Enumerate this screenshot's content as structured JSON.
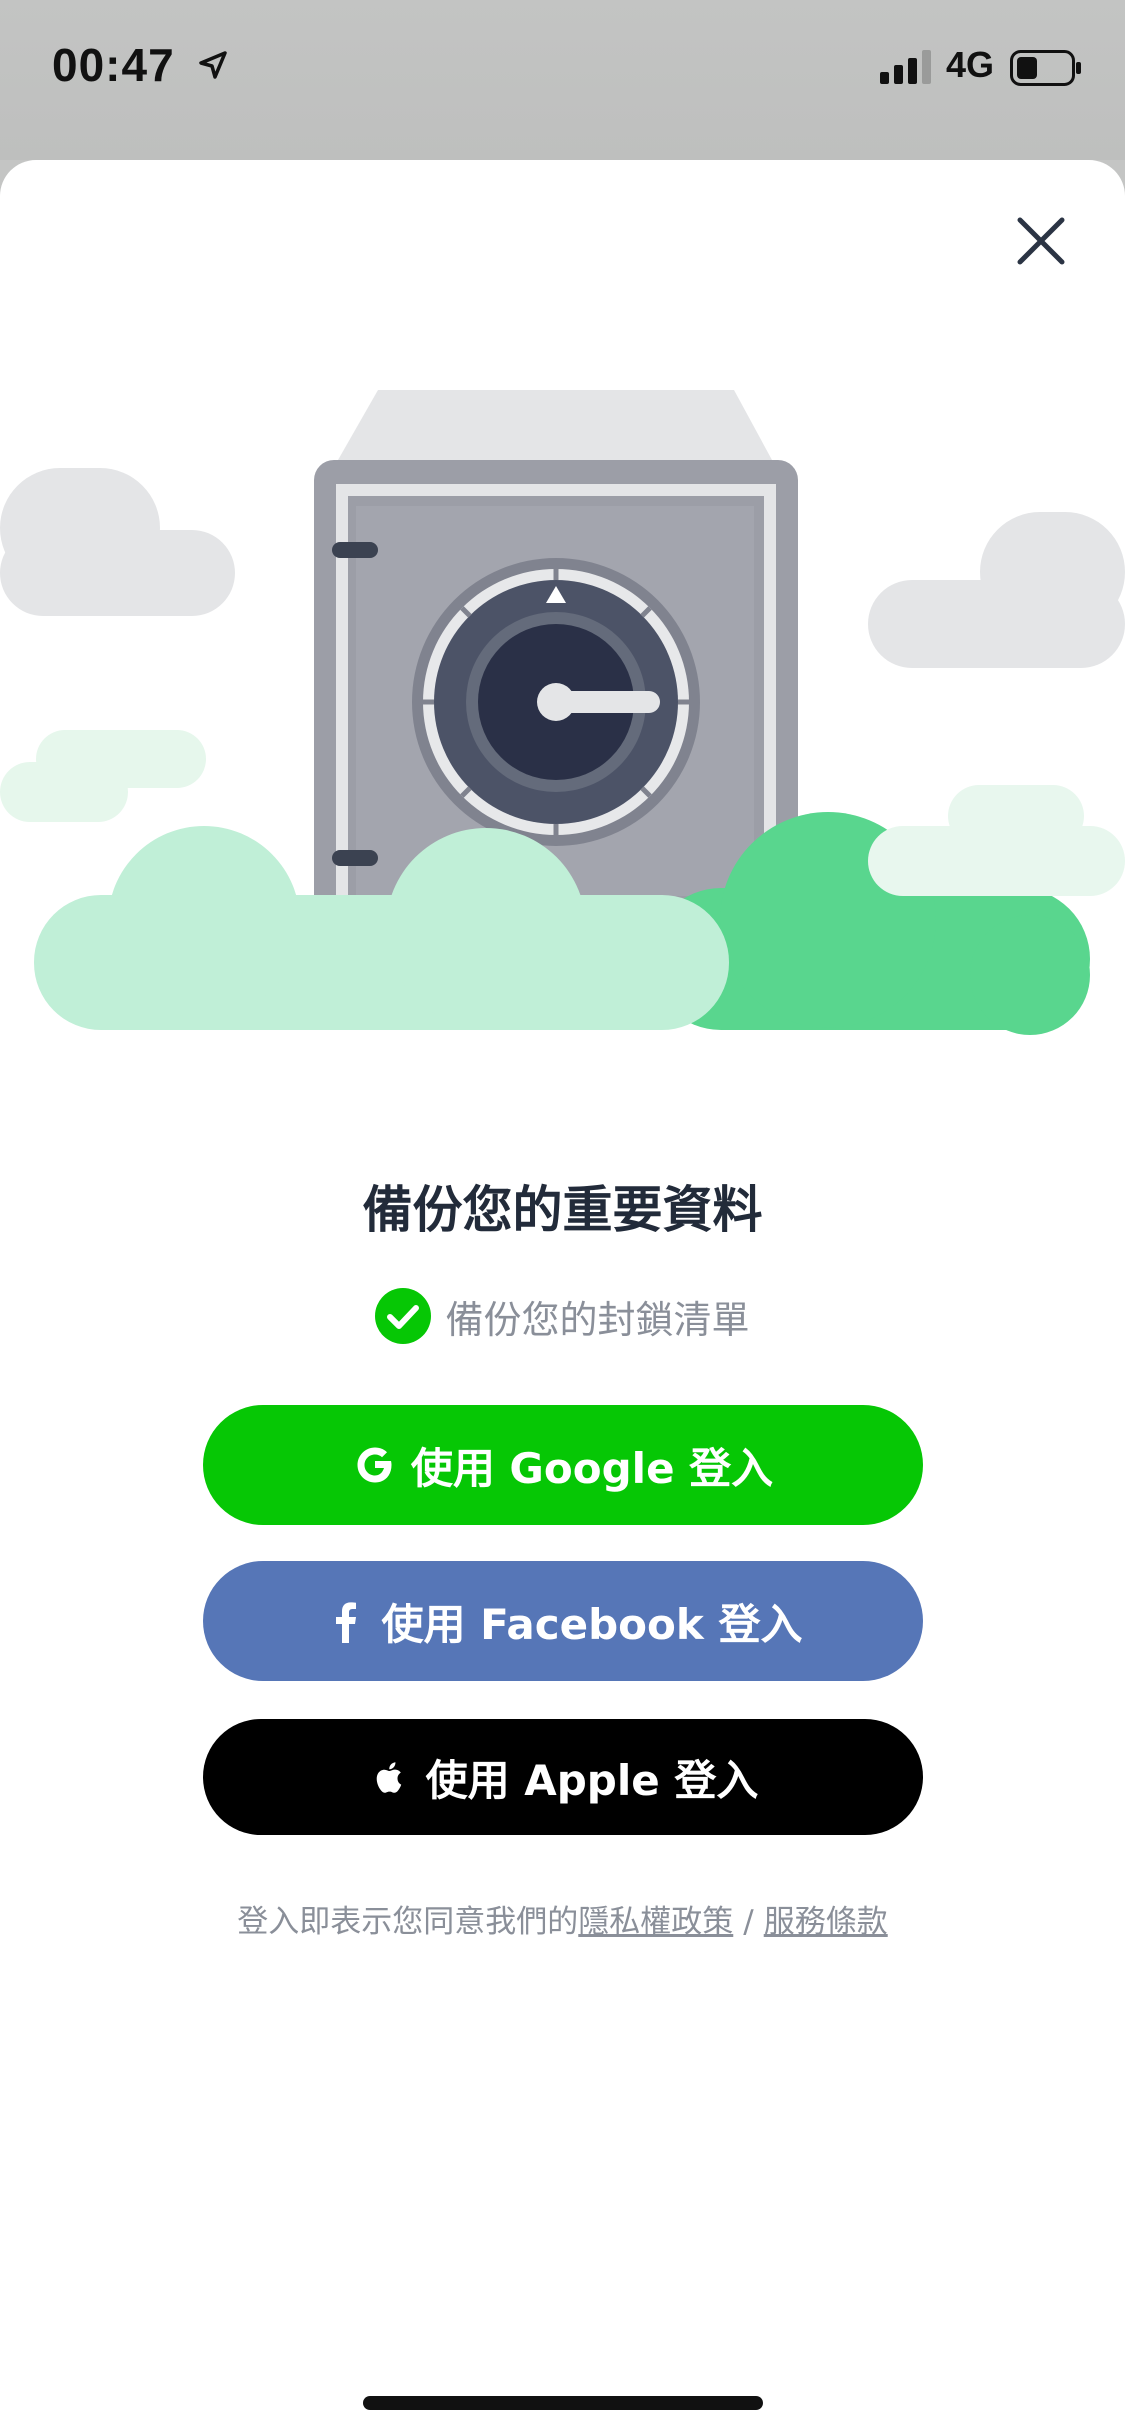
{
  "status_bar": {
    "time": "00:47",
    "network": "4G",
    "icons": [
      "location-arrow-icon",
      "cellular-signal-icon",
      "battery-icon"
    ]
  },
  "sheet": {
    "close_icon": "close-icon",
    "illustration": "safe-vault-with-clouds",
    "headline": "備份您的重要資料",
    "feature": "備份您的封鎖清單",
    "feature_icon": "check-circle-icon"
  },
  "buttons": {
    "google": {
      "label": "使用 Google 登入",
      "icon": "google-icon",
      "color": "#06c705"
    },
    "facebook": {
      "label": "使用 Facebook 登入",
      "icon": "facebook-icon",
      "color": "#5676b7"
    },
    "apple": {
      "label": "使用 Apple 登入",
      "icon": "apple-icon",
      "color": "#000000"
    }
  },
  "legal": {
    "prefix": "登入即表示您同意我們的",
    "privacy_link": "隱私權政策",
    "separator": "/",
    "terms_link": "服務條款"
  },
  "colors": {
    "accent_green": "#06c705",
    "headline": "#222b3a",
    "muted_text": "#8a8f99",
    "overlay": "#c4c5c4"
  }
}
